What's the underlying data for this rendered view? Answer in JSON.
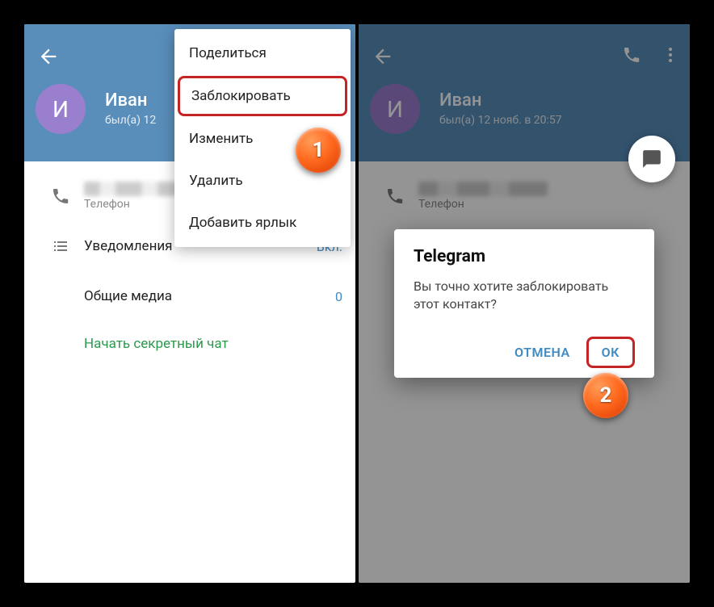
{
  "screen1": {
    "avatar_letter": "И",
    "name": "Иван",
    "status": "был(а) 12",
    "phone_label": "Телефон",
    "notifications_label": "Уведомления",
    "notifications_value": "Вкл.",
    "media_label": "Общие медиа",
    "media_value": "0",
    "secret_chat": "Начать секретный чат",
    "menu": {
      "share": "Поделиться",
      "block": "Заблокировать",
      "edit": "Изменить",
      "delete": "Удалить",
      "shortcut": "Добавить ярлык"
    },
    "step": "1"
  },
  "screen2": {
    "avatar_letter": "И",
    "name": "Иван",
    "status": "был(а) 12 нояб. в 20:57",
    "phone_label": "Телефон",
    "dialog": {
      "title": "Telegram",
      "text": "Вы точно хотите заблокировать этот контакт?",
      "cancel": "ОТМЕНА",
      "ok": "ОК"
    },
    "step": "2"
  }
}
